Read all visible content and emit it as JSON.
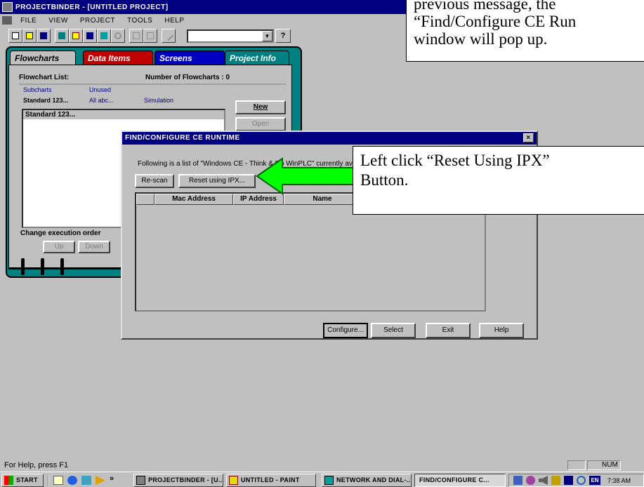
{
  "window": {
    "title": "ProjectBinder - [Untitled Project]"
  },
  "menu": [
    "File",
    "View",
    "Project",
    "Tools",
    "Help"
  ],
  "toolbar": {
    "combo_value": "",
    "help_glyph": "?"
  },
  "binder": {
    "tabs": [
      {
        "label": "Flowcharts",
        "color": "#000000",
        "bg": "#c0c0c0"
      },
      {
        "label": "Data Items",
        "color": "#ffffff",
        "bg": "#c00000"
      },
      {
        "label": "Screens",
        "color": "#ffffff",
        "bg": "#0000c0"
      },
      {
        "label": "Project Info",
        "color": "#ffffff",
        "bg": "#008080"
      }
    ],
    "flowchart_list_label": "Flowchart List:",
    "count_label": "Number of Flowcharts : 0",
    "subtabs_row1": [
      "Subcharts",
      "Unused"
    ],
    "subtabs_row2": [
      "Standard 123...",
      "All abc...",
      "Simulation"
    ],
    "list_item": "Standard 123...",
    "new_button": "New",
    "open_button": "Open",
    "change_order_label": "Change execution order",
    "up_button": "Up",
    "down_button": "Down"
  },
  "callout_top": {
    "line1": "previous message, the",
    "line2": "“Find/Configure CE Run",
    "line3": "window will pop up."
  },
  "callout_main": {
    "line1": "Left click “Reset Using IPX”",
    "line2": "Button."
  },
  "dialog": {
    "title": "Find/Configure CE Runtime",
    "close_glyph": "×",
    "description": "Following is a list of \"Windows CE - Think & Do WinPLC\" currently availa",
    "rescan_button": "Re-scan",
    "reset_ipx_button": "Reset using IPX...",
    "columns": [
      "Mac Address",
      "IP Address",
      "Name"
    ],
    "configure_button": "Configure...",
    "select_button": "Select",
    "exit_button": "Exit",
    "help_button": "Help"
  },
  "status": {
    "text": "For Help, press F1",
    "num": "NUM"
  },
  "taskbar": {
    "start": "Start",
    "more": "»",
    "tasks": [
      "ProjectBinder - [U...",
      "untitled - Paint",
      "Network and Dial-...",
      "Find/Configure C..."
    ],
    "lang": "EN",
    "clock": "7:38 AM"
  },
  "colors": {
    "arrow": "#00ff00",
    "titlebar": "#000080",
    "binder": "#008080",
    "desktop": "#c0c0c0"
  }
}
